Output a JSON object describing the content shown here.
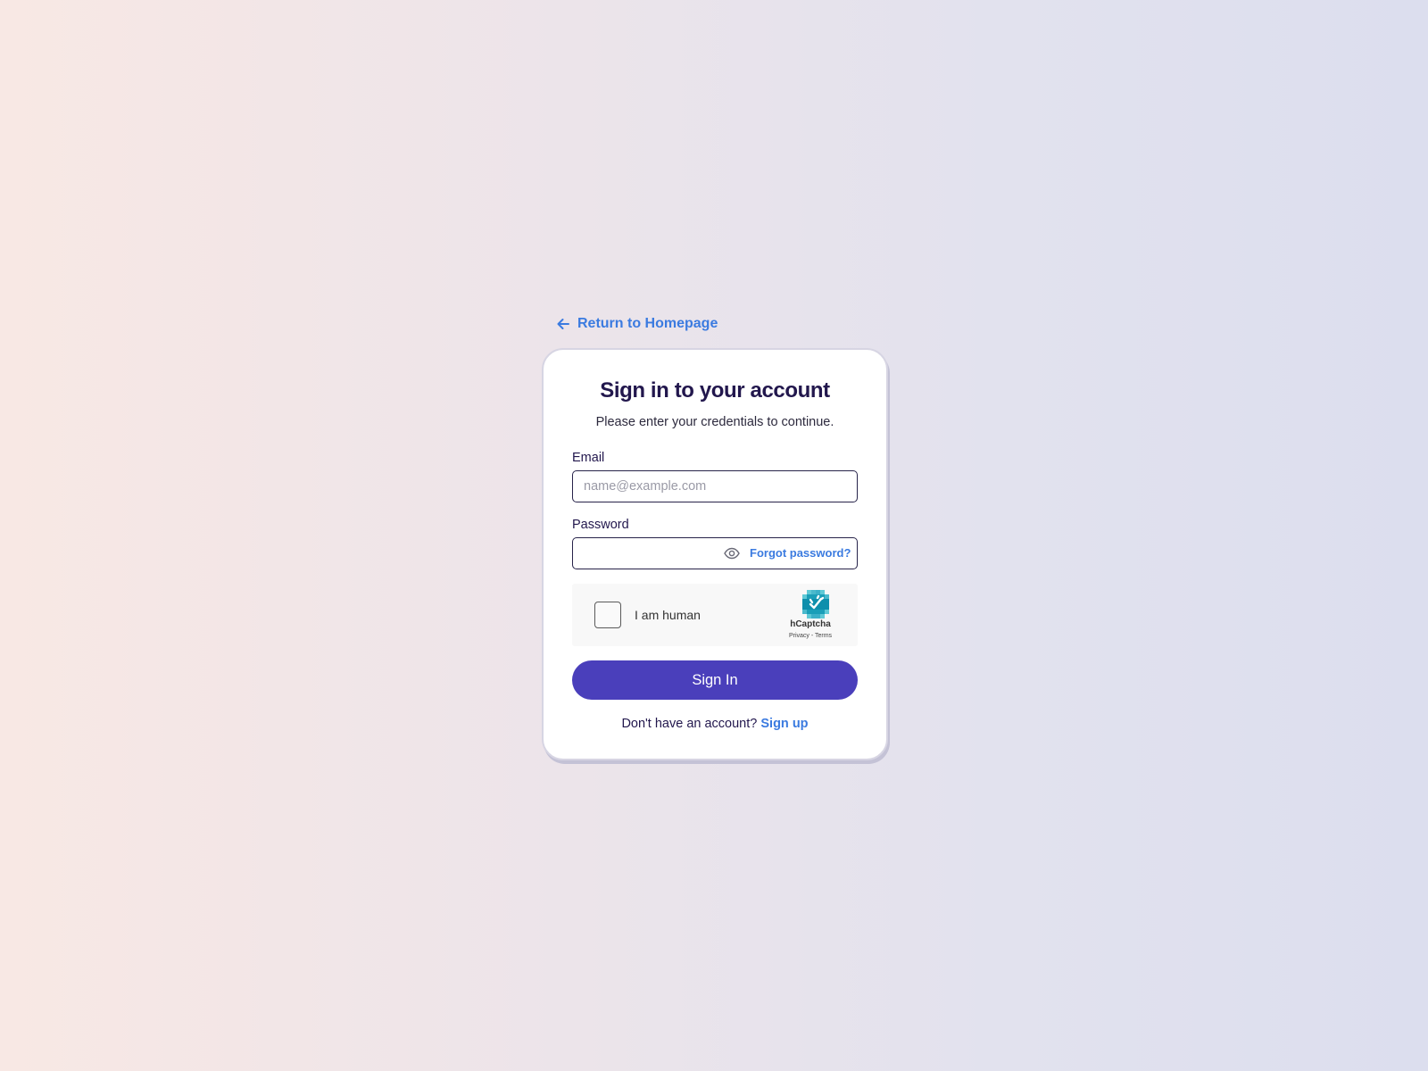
{
  "back_link": {
    "label": "Return to Homepage",
    "icon": "arrow-left-icon",
    "color": "#3b7be0"
  },
  "card": {
    "title": "Sign in to your account",
    "subtitle": "Please enter your credentials to continue."
  },
  "email": {
    "label": "Email",
    "placeholder": "name@example.com",
    "value": ""
  },
  "password": {
    "label": "Password",
    "value": "",
    "toggle_icon": "eye-icon",
    "forgot_label": "Forgot password?"
  },
  "captcha": {
    "checkbox_label": "I am human",
    "brand": "hCaptcha",
    "privacy": "Privacy",
    "separator": " - ",
    "terms": "Terms",
    "logo_icon": "hcaptcha-hand-icon"
  },
  "submit": {
    "label": "Sign In",
    "color": "#4a3fbb"
  },
  "signup": {
    "prompt": "Don't have an account?",
    "link": "Sign up"
  },
  "colors": {
    "accent": "#3b7be0",
    "primary": "#4a3fbb",
    "heading": "#22174d"
  }
}
